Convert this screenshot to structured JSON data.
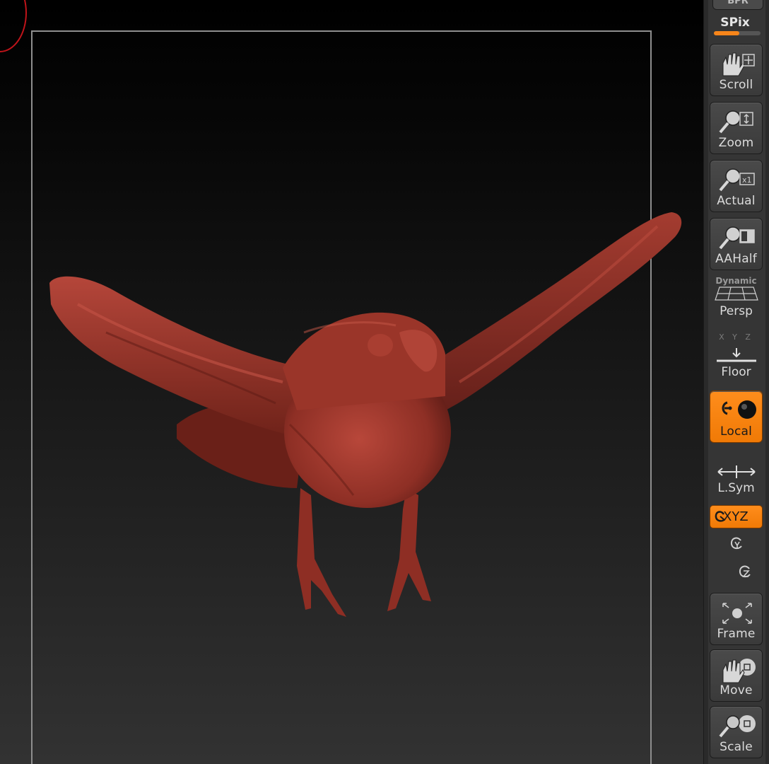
{
  "viewport": {
    "subject": "sculpted bird model",
    "material_color": "#a53a2e",
    "background_top": "#000000",
    "background_bottom": "#323232"
  },
  "shelf": {
    "top_stub_label": "BPR",
    "spix_label": "SPix",
    "spix_value": 0.55,
    "accent_color": "#f7851a",
    "buttons": [
      {
        "label": "Scroll",
        "icon": "scroll-hand-icon",
        "active": false
      },
      {
        "label": "Zoom",
        "icon": "zoom-magnifier-icon",
        "active": false
      },
      {
        "label": "Actual",
        "icon": "actual-size-icon",
        "active": false
      },
      {
        "label": "AAHalf",
        "icon": "aahalf-icon",
        "active": false
      },
      {
        "label": "Persp",
        "icon": "perspective-grid-icon",
        "active": false,
        "caption": "Dynamic"
      },
      {
        "label": "Floor",
        "icon": "floor-icon",
        "active": false,
        "axes": "X Y Z"
      },
      {
        "label": "Local",
        "icon": "local-pivot-icon",
        "active": true
      },
      {
        "label": "L.Sym",
        "icon": "local-symmetry-icon",
        "active": false
      },
      {
        "label": "XYZ",
        "icon": "rotate-xyz-icon",
        "active": true
      },
      {
        "label": "Frame",
        "icon": "frame-icon",
        "active": false
      },
      {
        "label": "Move",
        "icon": "move-hand-icon",
        "active": false
      },
      {
        "label": "Scale",
        "icon": "scale-icon",
        "active": false
      }
    ]
  }
}
